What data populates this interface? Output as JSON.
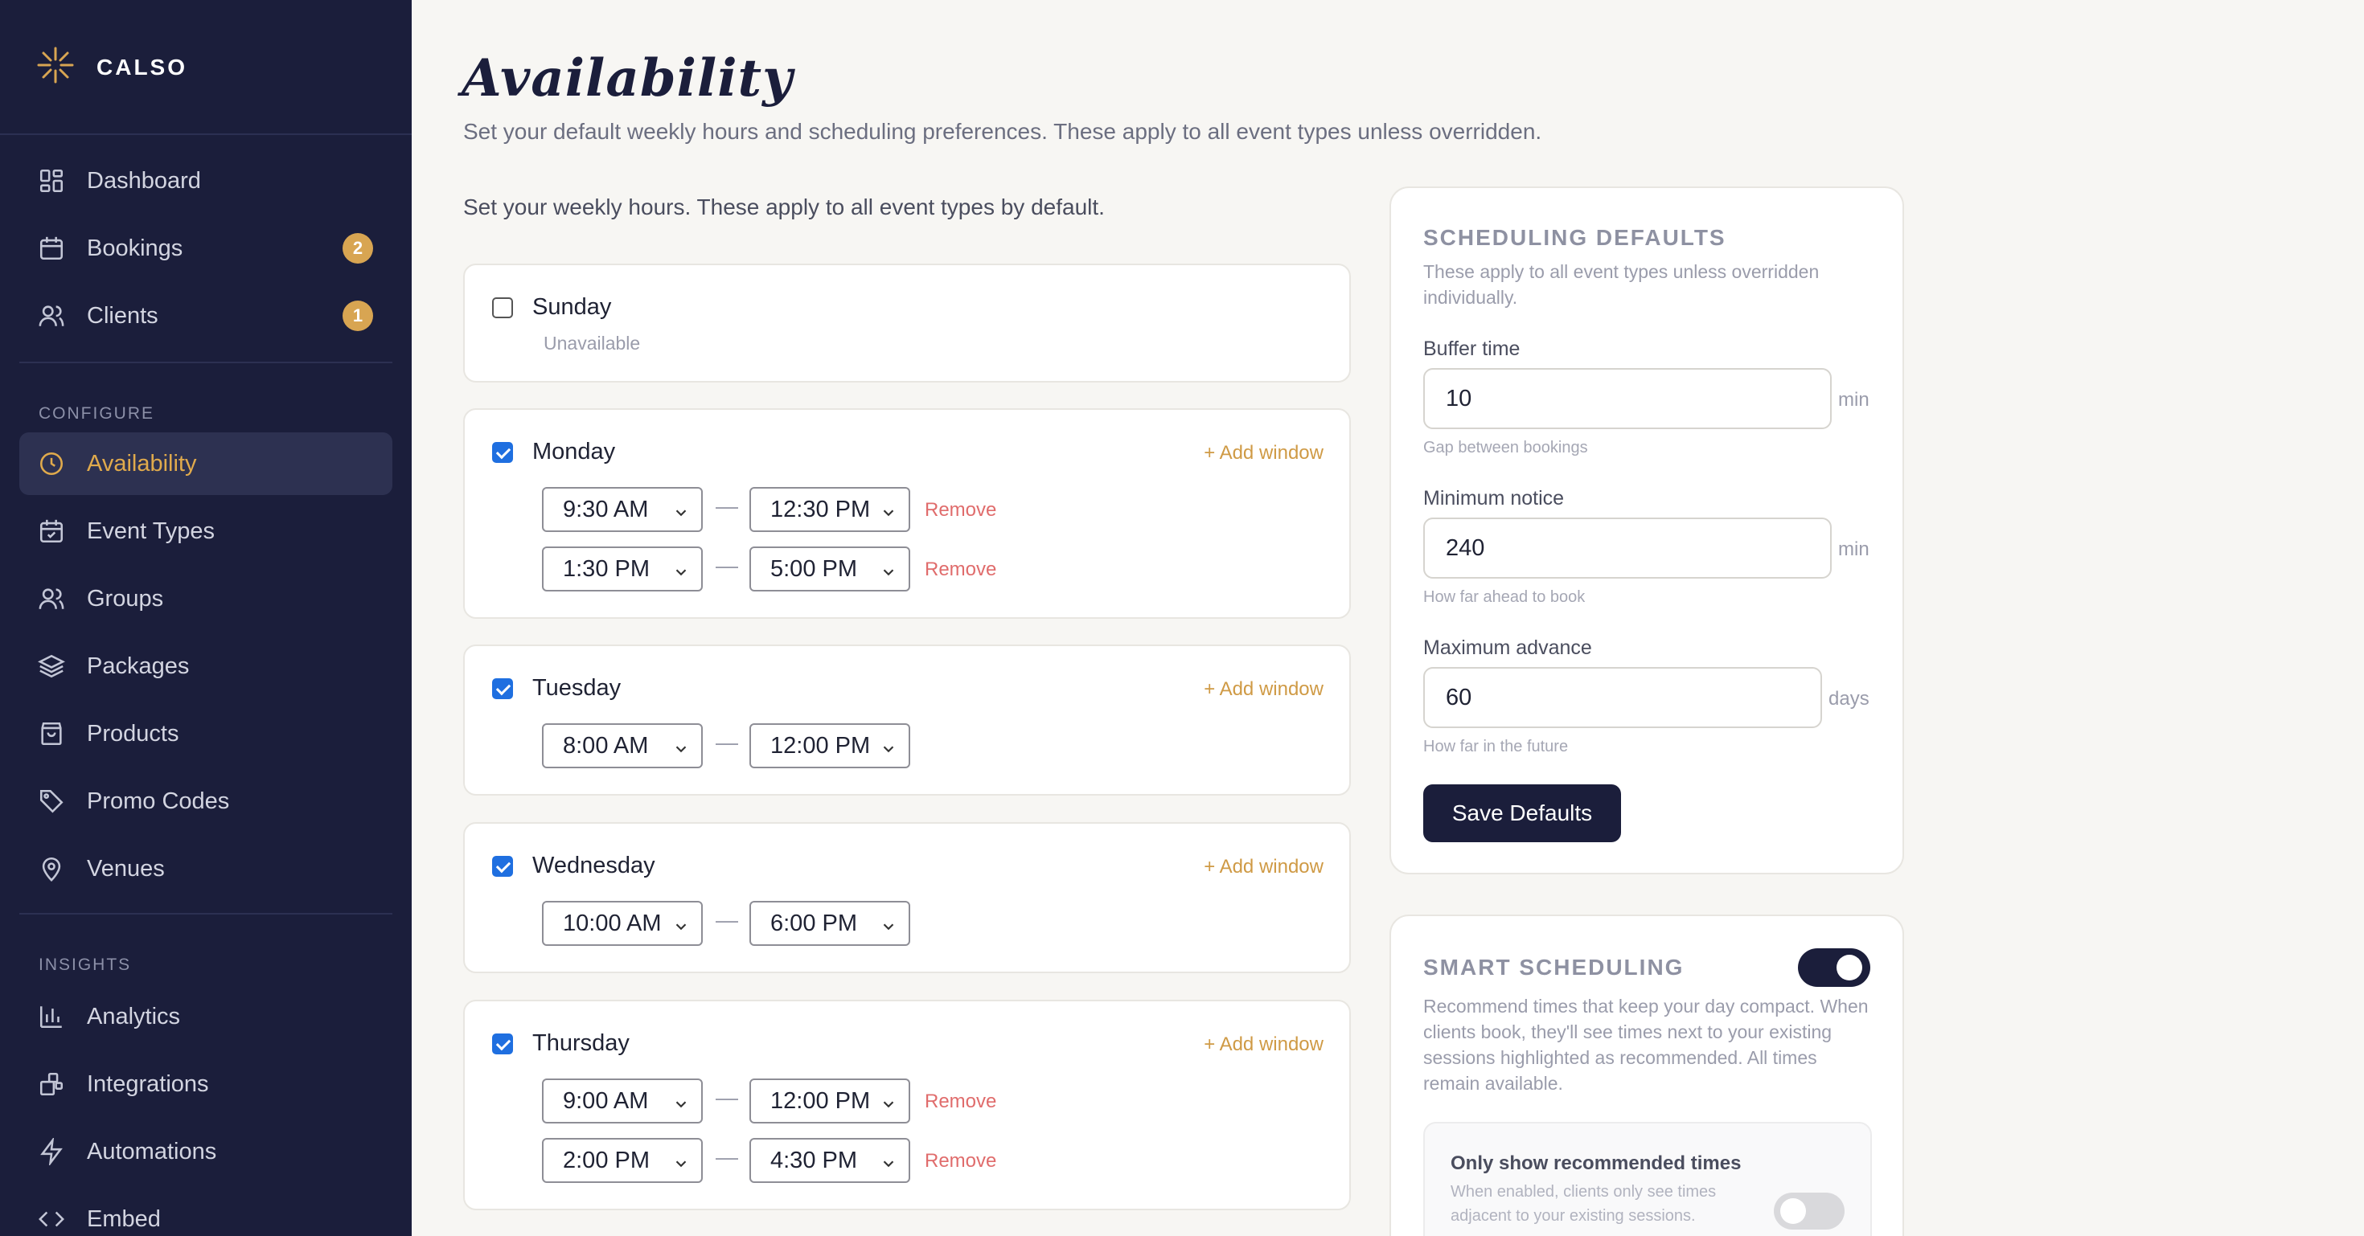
{
  "app": {
    "name": "CALSO"
  },
  "sidebar": {
    "main_items": [
      {
        "label": "Dashboard",
        "icon": "grid-icon"
      },
      {
        "label": "Bookings",
        "icon": "calendar-icon",
        "badge": "2"
      },
      {
        "label": "Clients",
        "icon": "users-icon",
        "badge": "1"
      }
    ],
    "configure_label": "CONFIGURE",
    "configure_items": [
      {
        "label": "Availability",
        "icon": "clock-icon",
        "active": true
      },
      {
        "label": "Event Types",
        "icon": "calendar-check-icon"
      },
      {
        "label": "Groups",
        "icon": "users-icon"
      },
      {
        "label": "Packages",
        "icon": "layers-icon"
      },
      {
        "label": "Products",
        "icon": "shopping-bag-icon"
      },
      {
        "label": "Promo Codes",
        "icon": "tag-icon"
      },
      {
        "label": "Venues",
        "icon": "map-pin-icon"
      }
    ],
    "insights_label": "INSIGHTS",
    "insights_items": [
      {
        "label": "Analytics",
        "icon": "bar-chart-icon"
      },
      {
        "label": "Integrations",
        "icon": "puzzle-icon"
      },
      {
        "label": "Automations",
        "icon": "zap-icon"
      },
      {
        "label": "Embed",
        "icon": "code-icon"
      }
    ]
  },
  "page": {
    "title": "Availability",
    "subtitle": "Set your default weekly hours and scheduling preferences. These apply to all event types unless overridden.",
    "weekly_intro": "Set your weekly hours. These apply to all event types by default."
  },
  "days": [
    {
      "name": "Sunday",
      "enabled": false,
      "status": "Unavailable",
      "windows": []
    },
    {
      "name": "Monday",
      "enabled": true,
      "add_label": "+ Add window",
      "windows": [
        {
          "start": "9:30 AM",
          "end": "12:30 PM",
          "remove": "Remove"
        },
        {
          "start": "1:30 PM",
          "end": "5:00 PM",
          "remove": "Remove"
        }
      ]
    },
    {
      "name": "Tuesday",
      "enabled": true,
      "add_label": "+ Add window",
      "windows": [
        {
          "start": "8:00 AM",
          "end": "12:00 PM"
        }
      ]
    },
    {
      "name": "Wednesday",
      "enabled": true,
      "add_label": "+ Add window",
      "windows": [
        {
          "start": "10:00 AM",
          "end": "6:00 PM"
        }
      ]
    },
    {
      "name": "Thursday",
      "enabled": true,
      "add_label": "+ Add window",
      "windows": [
        {
          "start": "9:00 AM",
          "end": "12:00 PM",
          "remove": "Remove"
        },
        {
          "start": "2:00 PM",
          "end": "4:30 PM",
          "remove": "Remove"
        }
      ]
    }
  ],
  "scheduling_defaults": {
    "heading": "SCHEDULING DEFAULTS",
    "description": "These apply to all event types unless overridden individually.",
    "buffer": {
      "label": "Buffer time",
      "value": "10",
      "unit": "min",
      "hint": "Gap between bookings"
    },
    "notice": {
      "label": "Minimum notice",
      "value": "240",
      "unit": "min",
      "hint": "How far ahead to book"
    },
    "advance": {
      "label": "Maximum advance",
      "value": "60",
      "unit": "days",
      "hint": "How far in the future"
    },
    "save_label": "Save Defaults"
  },
  "smart_scheduling": {
    "heading": "SMART SCHEDULING",
    "enabled": true,
    "description": "Recommend times that keep your day compact. When clients book, they'll see times next to your existing sessions highlighted as recommended. All times remain available.",
    "only_recommended": {
      "title": "Only show recommended times",
      "enabled": false,
      "description": "When enabled, clients only see times adjacent to your existing sessions."
    }
  },
  "colors": {
    "sidebar_bg": "#1b1e3b",
    "accent": "#e0aa4c",
    "badge": "#d8a552",
    "checkbox": "#1f6fe0",
    "remove": "#e06c6c"
  }
}
